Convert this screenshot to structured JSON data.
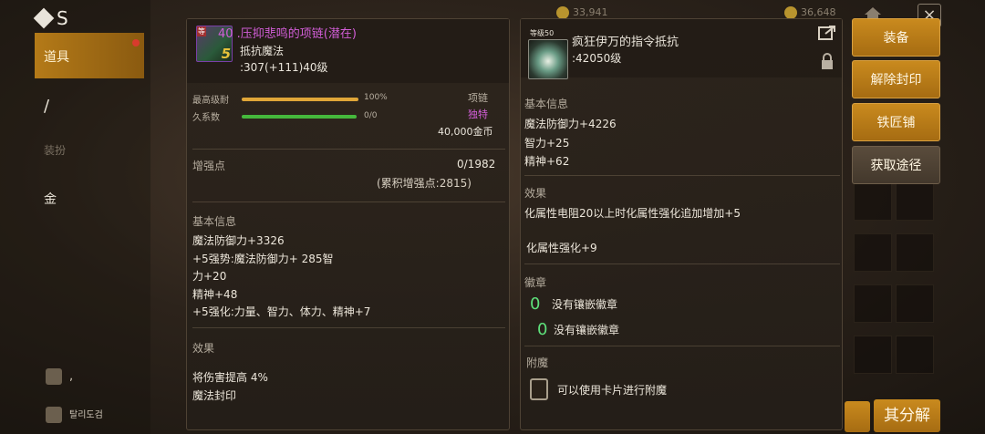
{
  "sidebar": {
    "logo": "S",
    "items": [
      {
        "label": "道具",
        "active": true
      },
      {
        "label": "/"
      },
      {
        "label": "装扮",
        "dim": true
      },
      {
        "label": "金"
      }
    ],
    "bottom": [
      {
        "label": ","
      },
      {
        "label": "탈리도검"
      }
    ]
  },
  "topbar": {
    "currency1": "33,941",
    "currency2": "36,648"
  },
  "left_panel": {
    "item_name": "40 .压抑悲鸣的项链(潜在)",
    "item_tag": "等",
    "item_level_num": "5",
    "subtitle": "抵抗魔法",
    "resist": ":307(+111)40级",
    "durability_label": "最高级耐",
    "durability_value": "100%",
    "durability_pct": 100,
    "endurance_label": "久系数",
    "endurance_value": "0/0",
    "endurance_pct": 100,
    "slot_type": "项链",
    "rarity": "独特",
    "price": "40,000金币",
    "enhance_label": "增强点",
    "enhance_value": "0/1982",
    "enhance_total": "(累积增强点:2815)",
    "basic_info_title": "基本信息",
    "stat1": "魔法防御力+3326",
    "stat2": "+5强势:魔法防御力+ 285智",
    "stat3": "力+20",
    "stat4": "精神+48",
    "stat5": "+5强化:力量、智力、体力、精神+7",
    "effect_title": "效果",
    "effect1": "将伤害提高 4%",
    "effect2": "魔法封印"
  },
  "right_panel": {
    "level_tag": "等级50",
    "item_name": "疯狂伊万的指令抵抗",
    "resist": ":42050级",
    "basic_info_title": "基本信息",
    "stat1": "魔法防御力+4226",
    "stat2": "智力+25",
    "stat3": "精神+62",
    "effect_title": "效果",
    "effect1": "化属性电阻20以上时化属性强化追加增加+5",
    "effect2": "化属性强化+9",
    "emblem_title": "徽章",
    "emblem_count1": "0",
    "emblem1": "没有镶嵌徽章",
    "emblem_count2": "0",
    "emblem2": "没有镶嵌徽章",
    "enchant_title": "附魔",
    "enchant_text": "可以使用卡片进行附魔"
  },
  "buttons": {
    "equip": "装备",
    "unseal": "解除封印",
    "blacksmith": "铁匠铺",
    "obtain": "获取途径",
    "dismantle": "其分解"
  }
}
